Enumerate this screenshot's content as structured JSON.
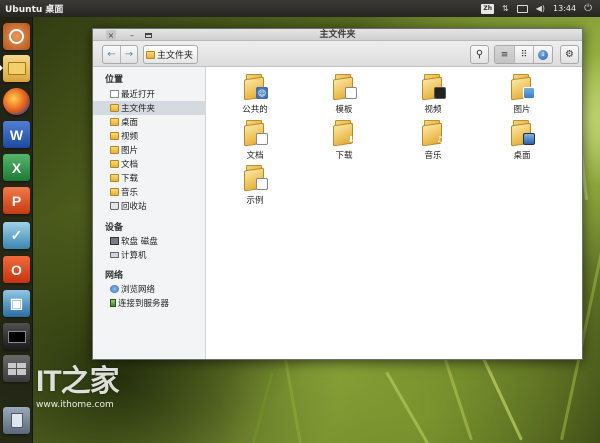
{
  "top_panel": {
    "title": "Ubuntu 桌面",
    "keyboard_indicator": "Zh",
    "clock": "13:44"
  },
  "launcher": {
    "items": [
      {
        "name": "Dash 主页",
        "icon": "ubuntu-logo-icon"
      },
      {
        "name": "主文件夹",
        "icon": "home-folder-icon"
      },
      {
        "name": "Firefox",
        "icon": "firefox-icon"
      },
      {
        "name": "Word",
        "icon": "word-icon",
        "glyph": "W"
      },
      {
        "name": "Excel",
        "icon": "excel-icon",
        "glyph": "X"
      },
      {
        "name": "PowerPoint",
        "icon": "powerpoint-icon",
        "glyph": "P"
      },
      {
        "name": "软件中心",
        "icon": "software-center-icon"
      },
      {
        "name": "Office",
        "icon": "office-icon",
        "glyph": "O"
      },
      {
        "name": "远程桌面",
        "icon": "remote-desktop-icon"
      },
      {
        "name": "终端",
        "icon": "terminal-icon"
      },
      {
        "name": "工作区",
        "icon": "workspace-switcher-icon"
      },
      {
        "name": "回收站",
        "icon": "trash-icon"
      }
    ]
  },
  "window": {
    "title": "主文件夹",
    "close_glyph": "×",
    "min_glyph": "–",
    "toolbar": {
      "back_glyph": "←",
      "forward_glyph": "→",
      "path_label": "主文件夹",
      "search_glyph": "⚲",
      "list_view_glyph": "≡",
      "grid_view_glyph": "⠿",
      "download_glyph": "↓",
      "settings_glyph": "⚙"
    },
    "sidebar": {
      "sections": [
        {
          "heading": "位置",
          "items": [
            {
              "label": "最近打开",
              "icon": "recent-icon"
            },
            {
              "label": "主文件夹",
              "icon": "home-folder-icon",
              "selected": true
            },
            {
              "label": "桌面",
              "icon": "desktop-folder-icon"
            },
            {
              "label": "视频",
              "icon": "videos-folder-icon"
            },
            {
              "label": "图片",
              "icon": "pictures-folder-icon"
            },
            {
              "label": "文档",
              "icon": "documents-folder-icon"
            },
            {
              "label": "下载",
              "icon": "downloads-folder-icon"
            },
            {
              "label": "音乐",
              "icon": "music-folder-icon"
            },
            {
              "label": "回收站",
              "icon": "trash-icon"
            }
          ]
        },
        {
          "heading": "设备",
          "items": [
            {
              "label": "软盘 磁盘",
              "icon": "floppy-disk-icon"
            },
            {
              "label": "计算机",
              "icon": "computer-icon"
            }
          ]
        },
        {
          "heading": "网络",
          "items": [
            {
              "label": "浏览网络",
              "icon": "network-icon"
            },
            {
              "label": "连接到服务器",
              "icon": "server-icon"
            }
          ]
        }
      ]
    },
    "folders": [
      {
        "label": "公共的",
        "icon": "public-folder-icon"
      },
      {
        "label": "模板",
        "icon": "templates-folder-icon"
      },
      {
        "label": "视频",
        "icon": "videos-folder-icon"
      },
      {
        "label": "图片",
        "icon": "pictures-folder-icon"
      },
      {
        "label": "文档",
        "icon": "documents-folder-icon"
      },
      {
        "label": "下载",
        "icon": "downloads-folder-icon"
      },
      {
        "label": "音乐",
        "icon": "music-folder-icon"
      },
      {
        "label": "桌面",
        "icon": "desktop-folder-icon"
      },
      {
        "label": "示例",
        "icon": "examples-folder-icon"
      }
    ]
  },
  "watermark": {
    "logo": "IT之家",
    "url": "www.ithome.com"
  }
}
